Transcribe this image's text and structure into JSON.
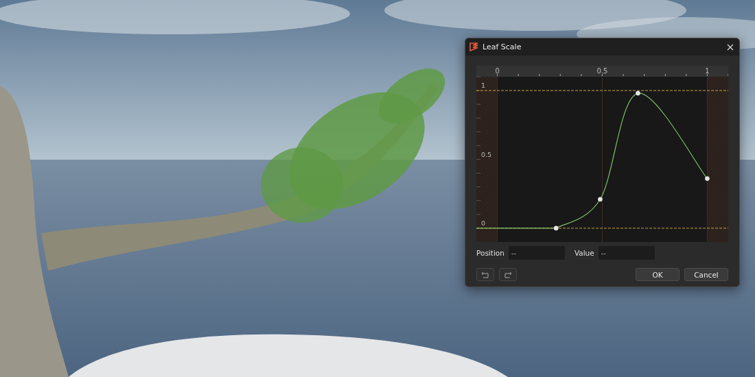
{
  "dialog": {
    "title": "Leaf Scale",
    "chart_data": {
      "type": "line",
      "x": [
        -0.1,
        0.28,
        0.49,
        0.67,
        1
      ],
      "series": [
        {
          "color": "#7fbf6a",
          "marker": "circle",
          "values": [
            0,
            0,
            0.21,
            0.98,
            0.36
          ]
        }
      ],
      "xlim": [
        -0.1,
        1.1
      ],
      "ylim": [
        -0.1,
        1.1
      ],
      "xticks": [
        0,
        0.5,
        1
      ],
      "yticks": [
        0,
        0.5,
        1
      ],
      "grid": true,
      "bands": [
        {
          "axis": "x",
          "from": 0,
          "to": 1
        }
      ],
      "ref_lines": [
        {
          "axis": "y",
          "value": 0
        },
        {
          "axis": "y",
          "value": 1
        }
      ]
    },
    "fields": [
      {
        "label": "Position",
        "value": "--"
      },
      {
        "label": "Value",
        "value": "--"
      }
    ],
    "buttons": [
      "OK",
      "Cancel"
    ]
  }
}
